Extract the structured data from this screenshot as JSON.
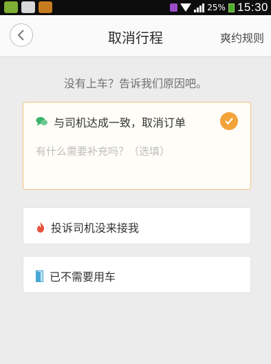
{
  "status_bar": {
    "battery_percent": "25%",
    "time": "15:30"
  },
  "header": {
    "title": "取消行程",
    "rules_link": "爽约规则"
  },
  "prompt": "没有上车？告诉我们原因吧。",
  "options": [
    {
      "label": "与司机达成一致，取消订单",
      "icon": "chat-bubble-icon",
      "icon_color": "#39b36b",
      "selected": true,
      "note_placeholder": "有什么需要补充吗？（选填）",
      "note_value": ""
    },
    {
      "label": "投诉司机没来接我",
      "icon": "flame-icon",
      "icon_color": "#e8543b",
      "selected": false
    },
    {
      "label": "已不需要用车",
      "icon": "door-icon",
      "icon_color": "#4aa6d6",
      "selected": false
    }
  ],
  "colors": {
    "accent": "#f2a33a",
    "selected_border": "#f3c07e"
  }
}
